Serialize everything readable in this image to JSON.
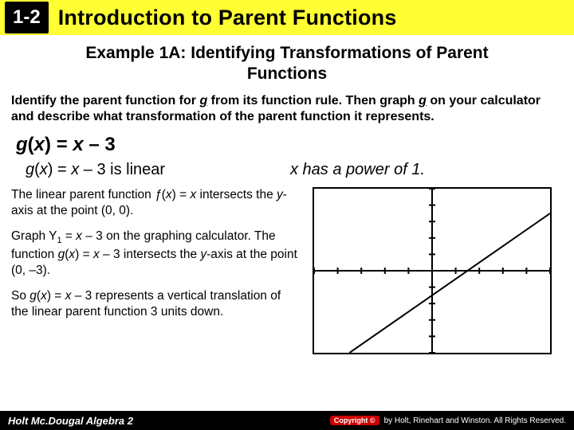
{
  "header": {
    "lesson": "1-2",
    "title": "Introduction to Parent Functions"
  },
  "example": {
    "title_line1": "Example 1A: Identifying Transformations of Parent",
    "title_line2": "Functions"
  },
  "instructions": {
    "pre": "Identify the parent function for ",
    "g": "g",
    "mid": " from its function rule. Then graph ",
    "g2": "g",
    "post": " on your calculator and describe what transformation of the parent function it represents."
  },
  "equation": {
    "lhs_g": "g",
    "lhs_open": "(",
    "lhs_x": "x",
    "lhs_close": ") = ",
    "rhs_x": "x",
    "rhs_tail": " – 3"
  },
  "linear_note": {
    "g": "g",
    "open": "(",
    "x": "x",
    "close": ") = ",
    "x2": "x",
    "tail": " – 3 is linear"
  },
  "power_note": "x has a power of 1.",
  "para1": {
    "a": "The linear parent function ",
    "f": "ƒ",
    "b": "(",
    "x": "x",
    "c": ") = ",
    "x2": "x",
    "d": " intersects the ",
    "y": "y",
    "e": "-axis at the point (0, 0)."
  },
  "para2": {
    "a": "Graph Y",
    "sub1": "1",
    "b": " = ",
    "x": "x",
    "c": " – 3 on the graphing calculator. The function ",
    "g": "g",
    "d": "(",
    "x2": "x",
    "e": ") = ",
    "x3": "x",
    "f": " – 3 intersects the ",
    "y": "y",
    "g2": "-axis at the point (0, –3)."
  },
  "para3": {
    "a": "So ",
    "g": "g",
    "b": "(",
    "x": "x",
    "c": ") = ",
    "x2": "x",
    "d": " – 3 represents a vertical translation of the linear parent function 3 units down."
  },
  "footer": {
    "left": "Holt Mc.Dougal Algebra 2",
    "badge": "Copyright ©",
    "right": "by Holt, Rinehart and Winston. All Rights Reserved."
  },
  "chart_data": {
    "type": "line",
    "title": "",
    "xlabel": "",
    "ylabel": "",
    "xlim": [
      -10,
      10
    ],
    "ylim": [
      -10,
      10
    ],
    "series": [
      {
        "name": "y = x - 3",
        "x": [
          -7,
          10
        ],
        "y": [
          -10,
          7
        ]
      }
    ],
    "ticks_x": [
      -10,
      -8,
      -6,
      -4,
      -2,
      0,
      2,
      4,
      6,
      8,
      10
    ],
    "ticks_y": [
      -10,
      -8,
      -6,
      -4,
      -2,
      0,
      2,
      4,
      6,
      8,
      10
    ]
  }
}
